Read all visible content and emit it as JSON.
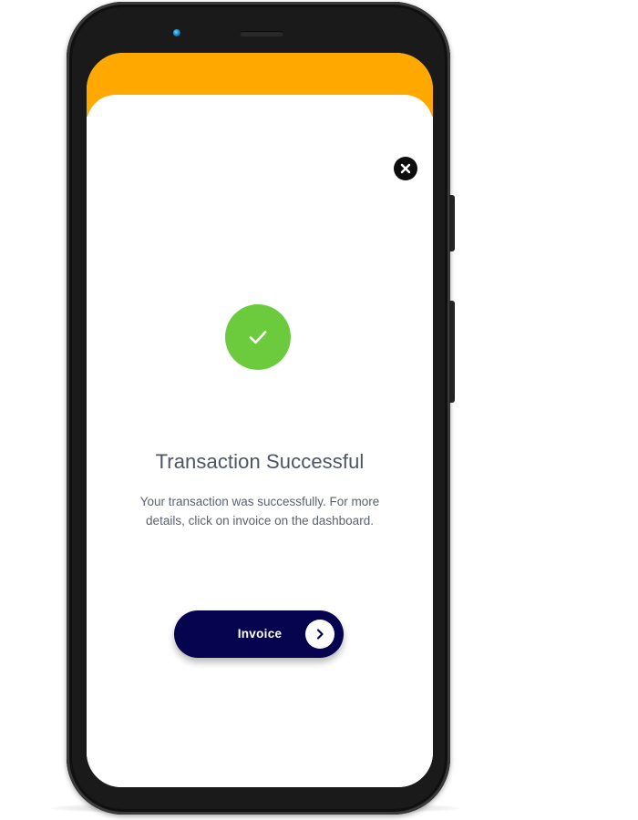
{
  "colors": {
    "accent": "#ffa800",
    "success": "#6ccb3d",
    "primary_button": "#06034f",
    "close_button": "#0d0d0d",
    "title_text": "#4b5563",
    "body_text": "#5b6270"
  },
  "icons": {
    "close": "close-icon",
    "success": "checkmark-icon",
    "invoice_arrow": "chevron-right-icon"
  },
  "modal": {
    "title": "Transaction Successful",
    "description": "Your transaction was successfully. For more details, click on invoice on the dashboard.",
    "invoice_button_label": "Invoice"
  }
}
